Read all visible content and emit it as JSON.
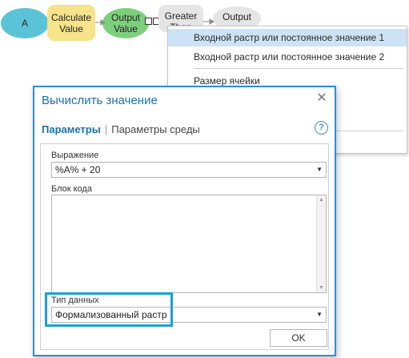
{
  "canvas": {
    "node_a": "A",
    "node_calculate": "Calculate Value",
    "node_output_value": "Output Value",
    "node_greater": "Greater Than",
    "node_output": "Output"
  },
  "context_menu": {
    "items": [
      "Входной растр или постоянное значение 1",
      "Входной растр или постоянное значение 2",
      "Размер ячейки"
    ]
  },
  "dialog": {
    "title": "Вычислить значение",
    "close_symbol": "✕",
    "tabs": {
      "parameters": "Параметры",
      "separator": "|",
      "environment": "Параметры среды"
    },
    "help_symbol": "?",
    "expression_label": "Выражение",
    "expression_value": "%A% + 20",
    "code_block_label": "Блок кода",
    "code_block_value": "",
    "data_type_label": "Тип данных",
    "data_type_value": "Формализованный растр",
    "ok_label": "OK"
  }
}
